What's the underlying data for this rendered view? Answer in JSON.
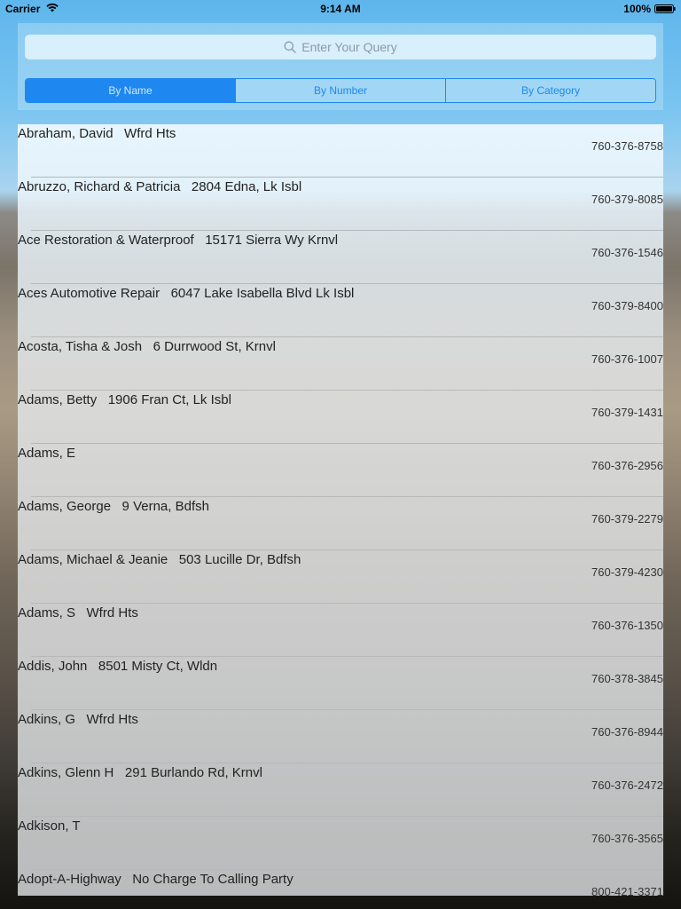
{
  "status_bar": {
    "carrier": "Carrier",
    "time": "9:14 AM",
    "battery": "100%"
  },
  "search": {
    "placeholder": "Enter Your Query",
    "icon": "search-icon"
  },
  "segments": [
    {
      "label": "By Name",
      "selected": true
    },
    {
      "label": "By Number",
      "selected": false
    },
    {
      "label": "By Category",
      "selected": false
    }
  ],
  "colors": {
    "accent": "#1e88f0"
  },
  "entries": [
    {
      "name": "Abraham, David   Wfrd Hts",
      "phone": "760-376-8758"
    },
    {
      "name": "Abruzzo, Richard & Patricia   2804 Edna, Lk Isbl",
      "phone": "760-379-8085"
    },
    {
      "name": "Ace Restoration & Waterproof   15171 Sierra Wy Krnvl",
      "phone": "760-376-1546"
    },
    {
      "name": "Aces Automotive Repair   6047 Lake Isabella Blvd Lk Isbl",
      "phone": "760-379-8400"
    },
    {
      "name": "Acosta, Tisha & Josh   6 Durrwood St, Krnvl",
      "phone": "760-376-1007"
    },
    {
      "name": "Adams, Betty   1906 Fran Ct, Lk Isbl",
      "phone": "760-379-1431"
    },
    {
      "name": "Adams, E",
      "phone": "760-376-2956"
    },
    {
      "name": "Adams, George   9 Verna, Bdfsh",
      "phone": "760-379-2279"
    },
    {
      "name": "Adams, Michael & Jeanie   503 Lucille Dr, Bdfsh",
      "phone": "760-379-4230"
    },
    {
      "name": "Adams, S   Wfrd Hts",
      "phone": "760-376-1350"
    },
    {
      "name": "Addis, John   8501 Misty Ct, Wldn",
      "phone": "760-378-3845"
    },
    {
      "name": "Adkins, G   Wfrd Hts",
      "phone": "760-376-8944"
    },
    {
      "name": "Adkins, Glenn H   291 Burlando Rd, Krnvl",
      "phone": "760-376-2472"
    },
    {
      "name": "Adkison, T",
      "phone": "760-376-3565"
    },
    {
      "name": "Adopt-A-Highway   No Charge To Calling Party",
      "phone": "800-421-3371"
    }
  ]
}
